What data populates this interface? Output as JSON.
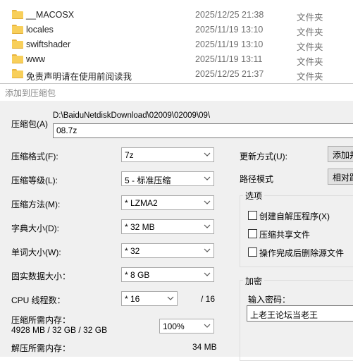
{
  "explorer": {
    "rows": [
      {
        "name": "__MACOSX",
        "date": "2025/12/25 21:38",
        "type": "文件夹"
      },
      {
        "name": "locales",
        "date": "2025/11/19 13:10",
        "type": "文件夹"
      },
      {
        "name": "swiftshader",
        "date": "2025/11/19 13:10",
        "type": "文件夹"
      },
      {
        "name": "www",
        "date": "2025/11/19 13:11",
        "type": "文件夹"
      },
      {
        "name": "免责声明请在使用前阅读我",
        "date": "2025/12/25 21:37",
        "type": "文件夹"
      }
    ]
  },
  "dialog": {
    "title": "添加到压缩包",
    "archive_label": "压缩包(A)",
    "archive_path": "D:\\BaiduNetdiskDownload\\02009\\02009\\09\\",
    "archive_name": "08.7z",
    "format_label": "压缩格式(F):",
    "format_value": "7z",
    "level_label": "压缩等级(L):",
    "level_value": "5 - 标准压缩",
    "method_label": "压缩方法(M):",
    "method_value": "* LZMA2",
    "dict_label": "字典大小(D):",
    "dict_value": "* 32 MB",
    "word_label": "单词大小(W):",
    "word_value": "* 32",
    "solid_label": "固实数据大小：",
    "solid_value": "* 8 GB",
    "threads_label": "CPU 线程数：",
    "threads_value": "* 16",
    "threads_total": "/ 16",
    "mem_compress_label": "压缩所需内存：",
    "mem_compress_value": "4928 MB / 32 GB / 32 GB",
    "mem_percent": "100%",
    "mem_decompress_label": "解压所需内存：",
    "mem_decompress_value": "34 MB",
    "update_label": "更新方式(U):",
    "update_button": "添加并",
    "path_mode_label": "路径模式",
    "path_mode_button": "相对路",
    "options_title": "选项",
    "opt_sfx": "创建自解压程序(X)",
    "opt_shared": "压缩共享文件",
    "opt_delete": "操作完成后删除源文件",
    "encrypt_title": "加密",
    "password_label": "输入密码：",
    "password_value": "上老王论坛当老王"
  }
}
